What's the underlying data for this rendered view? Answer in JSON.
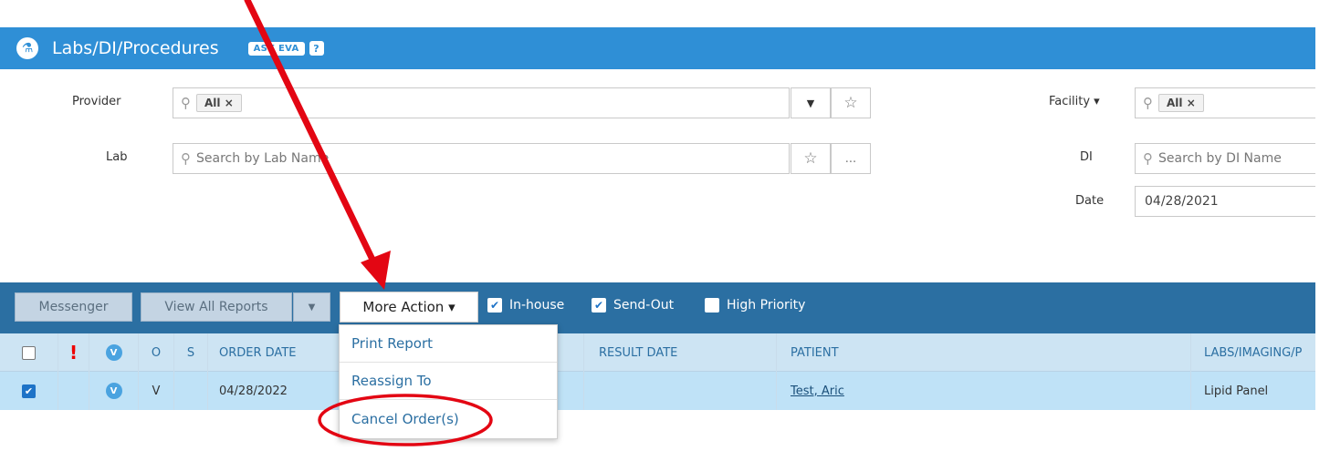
{
  "header": {
    "title": "Labs/DI/Procedures",
    "ask_eva": "ASK EVA",
    "help": "?"
  },
  "filters": {
    "provider_label": "Provider",
    "provider_chip": "All ×",
    "lab_label": "Lab",
    "lab_placeholder": "Search by Lab Name",
    "lab_more": "...",
    "facility_label": "Facility ▾",
    "facility_chip": "All ×",
    "di_label": "DI",
    "di_placeholder": "Search by DI Name",
    "date_label": "Date",
    "date_value": "04/28/2021"
  },
  "toolbar": {
    "messenger": "Messenger",
    "view_all_reports": "View All Reports",
    "more_action": "More Action ▾",
    "inhouse": "In-house",
    "sendout": "Send-Out",
    "high_priority": "High Priority"
  },
  "table": {
    "headers": {
      "o": "O",
      "s": "S",
      "order_date": "ORDER DATE",
      "result_date": "RESULT DATE",
      "patient": "PATIENT",
      "labs": "LABS/IMAGING/P"
    },
    "rows": [
      {
        "v": "V",
        "o": "V",
        "order_date": "04/28/2022",
        "result_date": "",
        "patient": "Test, Aric",
        "labs": "Lipid Panel"
      }
    ]
  },
  "more_action_menu": {
    "items": [
      "Print Report",
      "Reassign To",
      "Cancel Order(s)"
    ]
  },
  "colors": {
    "header_blue": "#2f8fd6",
    "toolbar_blue": "#2b6fa2",
    "annotation_red": "#e30613"
  }
}
